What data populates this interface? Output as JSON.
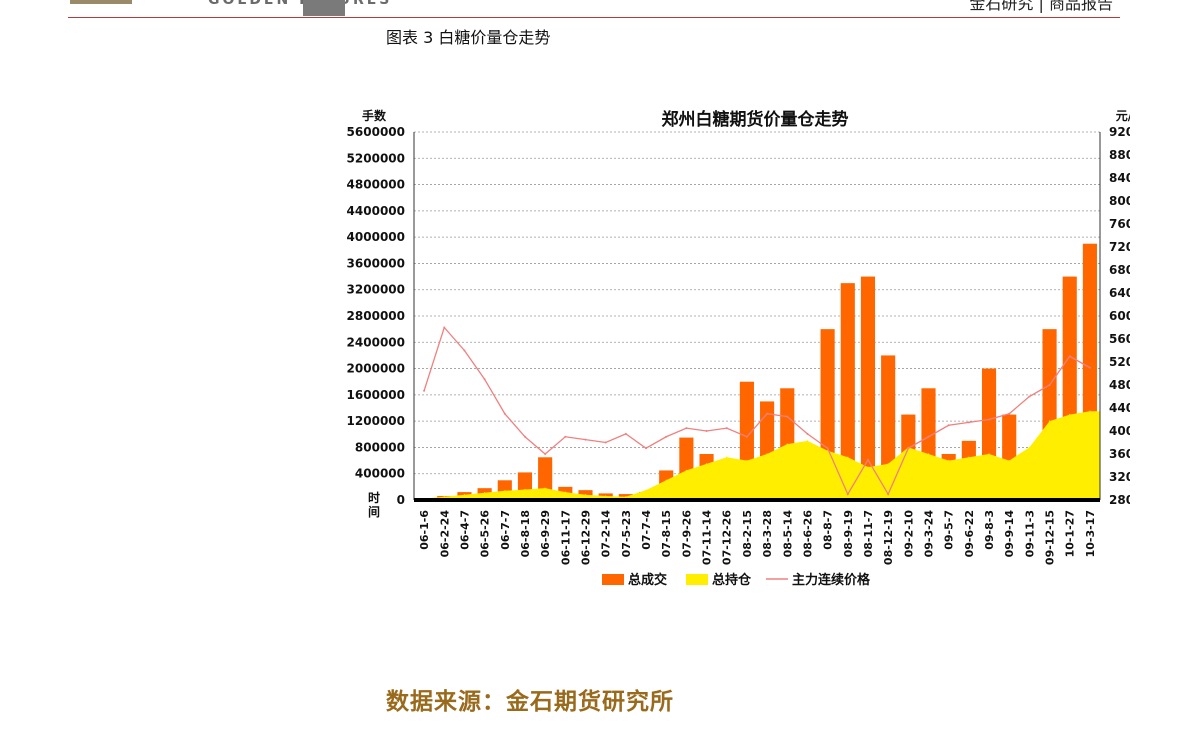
{
  "header": {
    "logo_text": "GOLDEN FUTURES",
    "right_text": "金石研究 | 商品报告"
  },
  "figure": {
    "caption": "图表 3 白糖价量仓走势"
  },
  "source": {
    "text": "数据来源：金石期货研究所"
  },
  "colors": {
    "volume": "#ff6600",
    "open_interest": "#ffee00",
    "price": "#f08080",
    "header_rule": "#b23b3b",
    "source_text": "#9a6a1c"
  },
  "chart_data": {
    "type": "area",
    "title": "郑州白糖期货价量仓走势",
    "y_left_label": "手数",
    "y_right_label": "元/吨",
    "x_label": "时间",
    "y_left_range": [
      0,
      5600000
    ],
    "y_left_ticks": [
      "5600000",
      "5200000",
      "4800000",
      "4400000",
      "4000000",
      "3600000",
      "3200000",
      "2800000",
      "2400000",
      "2000000",
      "1600000",
      "1200000",
      "800000",
      "400000",
      "0"
    ],
    "y_right_range": [
      2800,
      9200
    ],
    "y_right_ticks": [
      "9200",
      "8800",
      "8400",
      "8000",
      "7600",
      "7200",
      "6800",
      "6400",
      "6000",
      "5600",
      "5200",
      "4800",
      "4400",
      "4000",
      "3600",
      "3200",
      "2800"
    ],
    "categories": [
      "06-1-6",
      "06-2-24",
      "06-4-7",
      "06-5-26",
      "06-7-7",
      "06-8-18",
      "06-9-29",
      "06-11-17",
      "06-12-29",
      "07-2-14",
      "07-5-23",
      "07-7-4",
      "07-8-15",
      "07-9-26",
      "07-11-14",
      "07-12-26",
      "08-2-15",
      "08-3-28",
      "08-5-14",
      "08-6-26",
      "08-8-7",
      "08-9-19",
      "08-11-7",
      "08-12-19",
      "09-2-10",
      "09-3-24",
      "09-5-7",
      "09-6-22",
      "09-8-3",
      "09-9-14",
      "09-11-3",
      "09-12-15",
      "10-1-27",
      "10-3-17"
    ],
    "grid": true,
    "legend_position": "bottom",
    "series": [
      {
        "name": "总成交",
        "type": "bar",
        "values": [
          10000,
          60000,
          120000,
          180000,
          300000,
          420000,
          650000,
          200000,
          150000,
          100000,
          90000,
          120000,
          450000,
          950000,
          700000,
          600000,
          1800000,
          1500000,
          1700000,
          800000,
          2600000,
          3300000,
          3400000,
          2200000,
          1300000,
          1700000,
          700000,
          900000,
          2000000,
          1300000,
          700000,
          2600000,
          3400000,
          3900000
        ]
      },
      {
        "name": "总持仓",
        "type": "area",
        "values": [
          20000,
          50000,
          80000,
          110000,
          140000,
          160000,
          180000,
          120000,
          80000,
          60000,
          50000,
          150000,
          300000,
          450000,
          550000,
          650000,
          600000,
          700000,
          850000,
          900000,
          750000,
          650000,
          500000,
          550000,
          800000,
          700000,
          600000,
          650000,
          700000,
          600000,
          800000,
          1200000,
          1300000,
          1350000
        ]
      },
      {
        "name": "主力连续价格",
        "type": "line",
        "values": [
          4700,
          5800,
          5400,
          4900,
          4300,
          3900,
          3600,
          3900,
          3850,
          3800,
          3950,
          3700,
          3900,
          4050,
          4000,
          4050,
          3900,
          4300,
          4250,
          3950,
          3700,
          2900,
          3500,
          2900,
          3700,
          3900,
          4100,
          4150,
          4200,
          4300,
          4600,
          4800,
          5300,
          5100
        ]
      }
    ]
  }
}
